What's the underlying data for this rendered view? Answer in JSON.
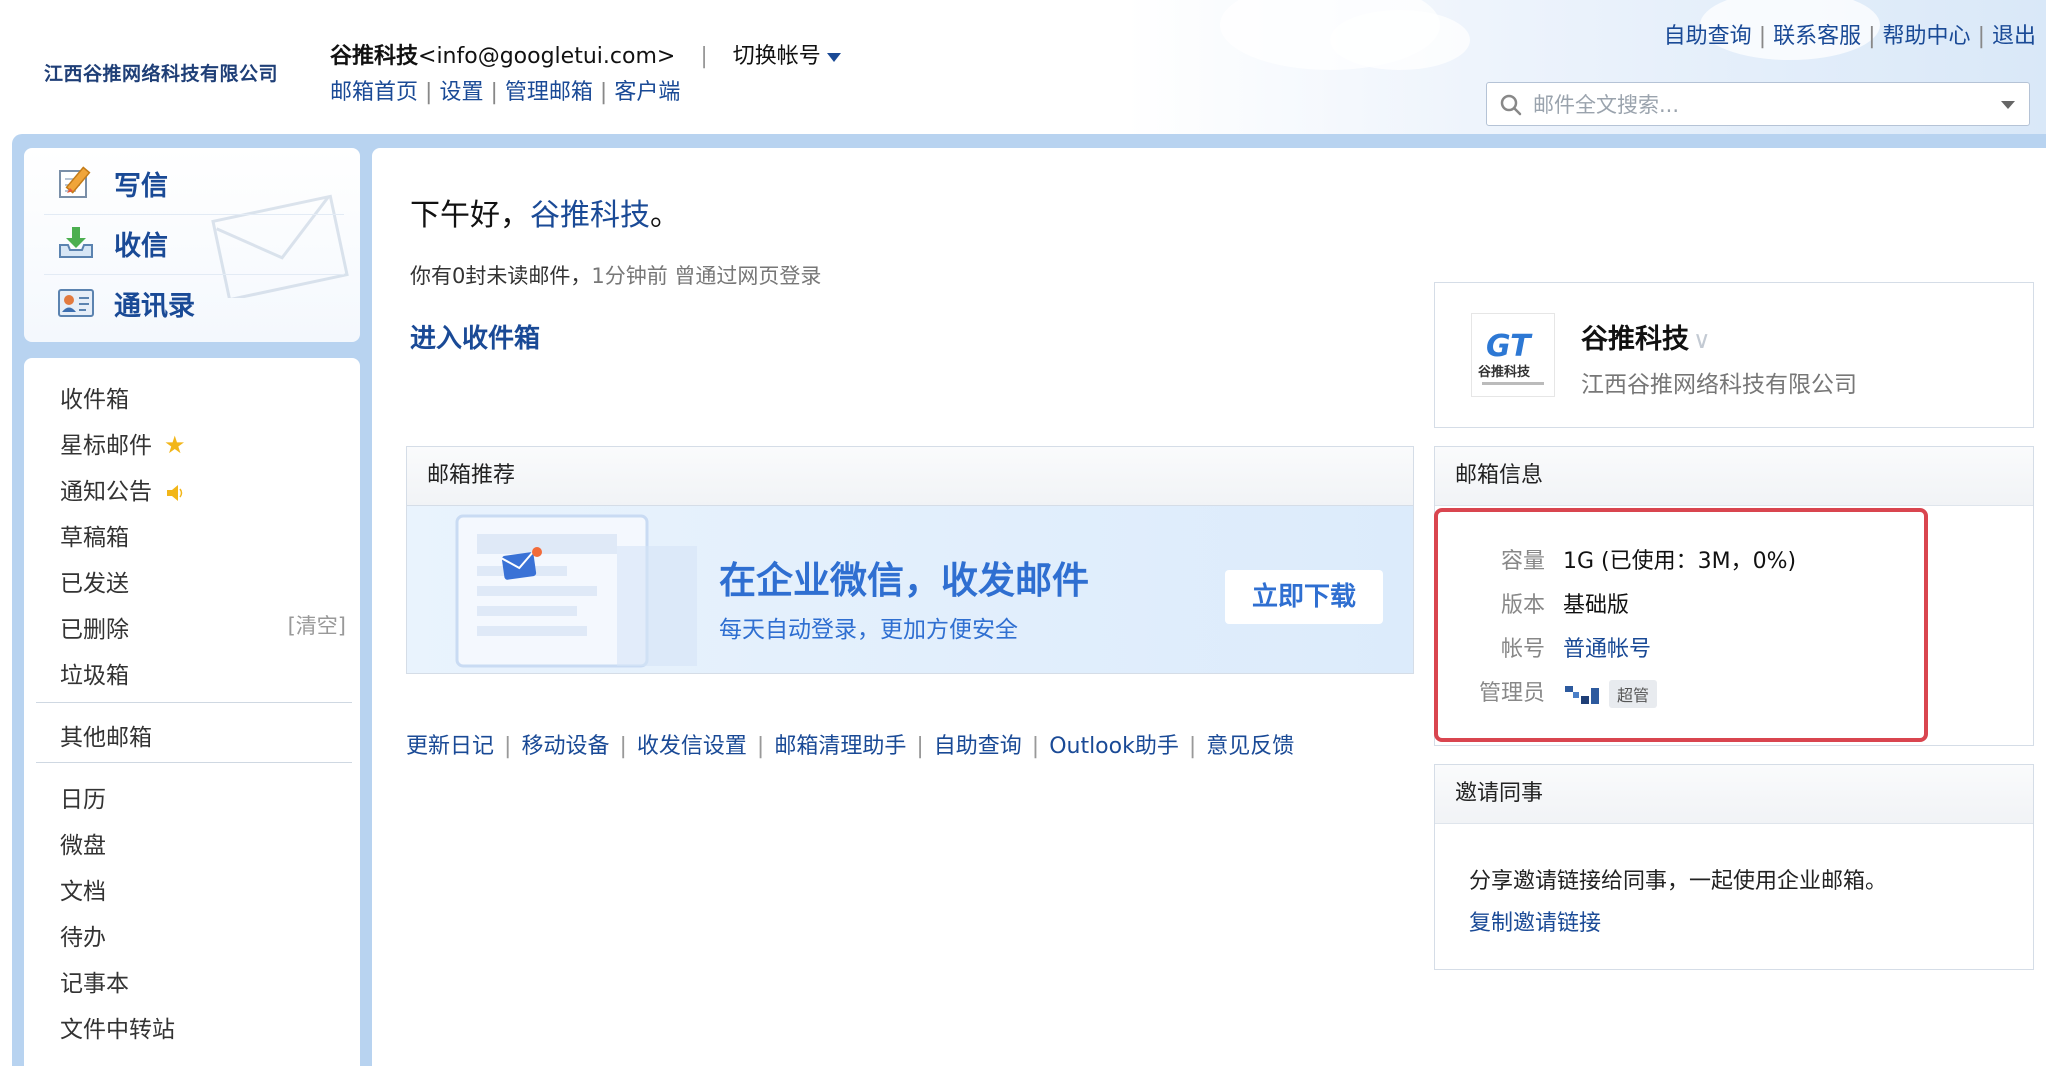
{
  "header": {
    "org_logo_text": "江西谷推网络科技有限公司",
    "user_name": "谷推科技",
    "user_email": "<info@googletui.com>",
    "separator": "|",
    "switch_account": "切换帐号",
    "nav": [
      "邮箱首页",
      "设置",
      "管理邮箱",
      "客户端"
    ],
    "top_links": [
      "自助查询",
      "联系客服",
      "帮助中心",
      "退出"
    ],
    "search_placeholder": "邮件全文搜索..."
  },
  "sidebar": {
    "quick": [
      {
        "label": "写信",
        "icon": "compose-icon"
      },
      {
        "label": "收信",
        "icon": "inbox-download-icon"
      },
      {
        "label": "通讯录",
        "icon": "contacts-card-icon"
      }
    ],
    "folders": [
      "收件箱",
      "星标邮件",
      "通知公告",
      "草稿箱",
      "已发送",
      "已删除",
      "垃圾箱"
    ],
    "clear_label": "[清空]",
    "other": "其他邮箱",
    "apps": [
      "日历",
      "微盘",
      "文档",
      "待办",
      "记事本",
      "文件中转站"
    ]
  },
  "main": {
    "greeting_prefix": "下午好，",
    "greeting_name": "谷推科技",
    "greeting_suffix": "。",
    "unread_text": "你有0封未读邮件，",
    "login_text": "1分钟前 曾通过网页登录",
    "enter_inbox": "进入收件箱",
    "recommend": {
      "header": "邮箱推荐",
      "title": "在企业微信，收发邮件",
      "subtitle": "每天自动登录，更加方便安全",
      "button": "立即下载"
    },
    "bottom_links": [
      "更新日记",
      "移动设备",
      "收发信设置",
      "邮箱清理助手",
      "自助查询",
      "Outlook助手",
      "意见反馈"
    ]
  },
  "company": {
    "name": "谷推科技",
    "full_name": "江西谷推网络科技有限公司",
    "logo_text": "谷推科技"
  },
  "mailbox_info": {
    "header": "邮箱信息",
    "rows": [
      {
        "key": "容量",
        "value": "1G (已使用：3M，0%)"
      },
      {
        "key": "版本",
        "value": "基础版"
      },
      {
        "key": "帐号",
        "value": "普通帐号"
      },
      {
        "key": "管理员",
        "value": "超管"
      }
    ]
  },
  "invite": {
    "header": "邀请同事",
    "text": "分享邀请链接给同事，一起使用企业邮箱。",
    "link": "复制邀请链接"
  },
  "colors": {
    "link": "#1a4a96",
    "frame": "#b8d3f0",
    "promo": "#2f6fd1",
    "highlight": "#d9454f",
    "star": "#f2b619"
  }
}
